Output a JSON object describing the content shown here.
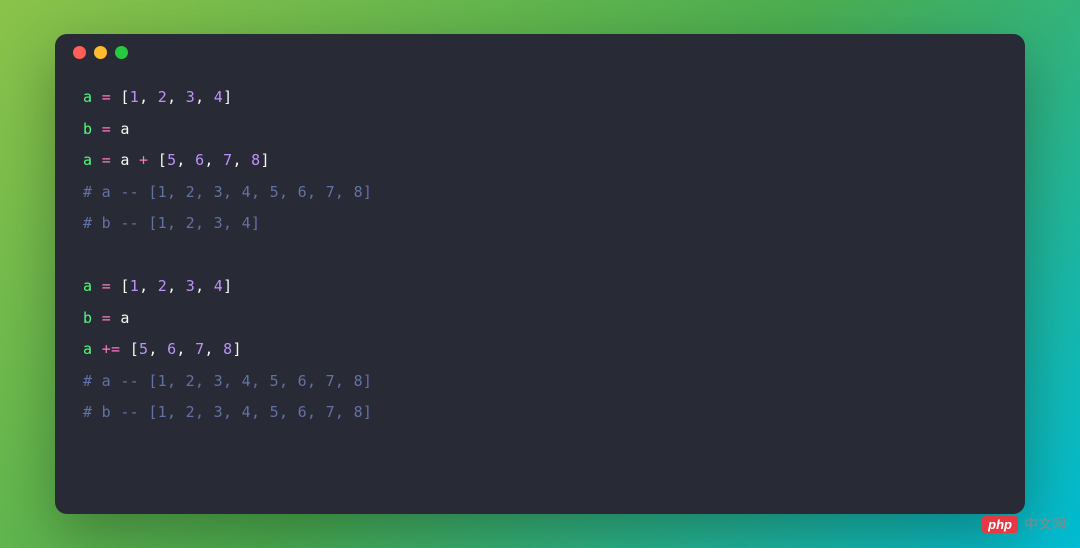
{
  "window": {
    "dots": [
      "red",
      "yellow",
      "green"
    ]
  },
  "code": {
    "lines": [
      {
        "type": "code",
        "tokens": [
          {
            "cls": "var",
            "t": "a"
          },
          {
            "cls": "",
            "t": " "
          },
          {
            "cls": "op",
            "t": "="
          },
          {
            "cls": "",
            "t": " "
          },
          {
            "cls": "bracket",
            "t": "["
          },
          {
            "cls": "num",
            "t": "1"
          },
          {
            "cls": "punct",
            "t": ", "
          },
          {
            "cls": "num",
            "t": "2"
          },
          {
            "cls": "punct",
            "t": ", "
          },
          {
            "cls": "num",
            "t": "3"
          },
          {
            "cls": "punct",
            "t": ", "
          },
          {
            "cls": "num",
            "t": "4"
          },
          {
            "cls": "bracket",
            "t": "]"
          }
        ]
      },
      {
        "type": "code",
        "tokens": [
          {
            "cls": "var",
            "t": "b"
          },
          {
            "cls": "",
            "t": " "
          },
          {
            "cls": "op",
            "t": "="
          },
          {
            "cls": "",
            "t": " a"
          }
        ]
      },
      {
        "type": "code",
        "tokens": [
          {
            "cls": "var",
            "t": "a"
          },
          {
            "cls": "",
            "t": " "
          },
          {
            "cls": "op",
            "t": "="
          },
          {
            "cls": "",
            "t": " a "
          },
          {
            "cls": "op",
            "t": "+"
          },
          {
            "cls": "",
            "t": " "
          },
          {
            "cls": "bracket",
            "t": "["
          },
          {
            "cls": "num",
            "t": "5"
          },
          {
            "cls": "punct",
            "t": ", "
          },
          {
            "cls": "num",
            "t": "6"
          },
          {
            "cls": "punct",
            "t": ", "
          },
          {
            "cls": "num",
            "t": "7"
          },
          {
            "cls": "punct",
            "t": ", "
          },
          {
            "cls": "num",
            "t": "8"
          },
          {
            "cls": "bracket",
            "t": "]"
          }
        ]
      },
      {
        "type": "comment",
        "text": "# a -- [1, 2, 3, 4, 5, 6, 7, 8]"
      },
      {
        "type": "comment",
        "text": "# b -- [1, 2, 3, 4]"
      },
      {
        "type": "blank",
        "text": ""
      },
      {
        "type": "code",
        "tokens": [
          {
            "cls": "var",
            "t": "a"
          },
          {
            "cls": "",
            "t": " "
          },
          {
            "cls": "op",
            "t": "="
          },
          {
            "cls": "",
            "t": " "
          },
          {
            "cls": "bracket",
            "t": "["
          },
          {
            "cls": "num",
            "t": "1"
          },
          {
            "cls": "punct",
            "t": ", "
          },
          {
            "cls": "num",
            "t": "2"
          },
          {
            "cls": "punct",
            "t": ", "
          },
          {
            "cls": "num",
            "t": "3"
          },
          {
            "cls": "punct",
            "t": ", "
          },
          {
            "cls": "num",
            "t": "4"
          },
          {
            "cls": "bracket",
            "t": "]"
          }
        ]
      },
      {
        "type": "code",
        "tokens": [
          {
            "cls": "var",
            "t": "b"
          },
          {
            "cls": "",
            "t": " "
          },
          {
            "cls": "op",
            "t": "="
          },
          {
            "cls": "",
            "t": " a"
          }
        ]
      },
      {
        "type": "code",
        "tokens": [
          {
            "cls": "var",
            "t": "a"
          },
          {
            "cls": "",
            "t": " "
          },
          {
            "cls": "op",
            "t": "+="
          },
          {
            "cls": "",
            "t": " "
          },
          {
            "cls": "bracket",
            "t": "["
          },
          {
            "cls": "num",
            "t": "5"
          },
          {
            "cls": "punct",
            "t": ", "
          },
          {
            "cls": "num",
            "t": "6"
          },
          {
            "cls": "punct",
            "t": ", "
          },
          {
            "cls": "num",
            "t": "7"
          },
          {
            "cls": "punct",
            "t": ", "
          },
          {
            "cls": "num",
            "t": "8"
          },
          {
            "cls": "bracket",
            "t": "]"
          }
        ]
      },
      {
        "type": "comment",
        "text": "# a -- [1, 2, 3, 4, 5, 6, 7, 8]"
      },
      {
        "type": "comment",
        "text": "# b -- [1, 2, 3, 4, 5, 6, 7, 8]"
      }
    ]
  },
  "watermark": {
    "badge": "php",
    "text": "中文网"
  }
}
